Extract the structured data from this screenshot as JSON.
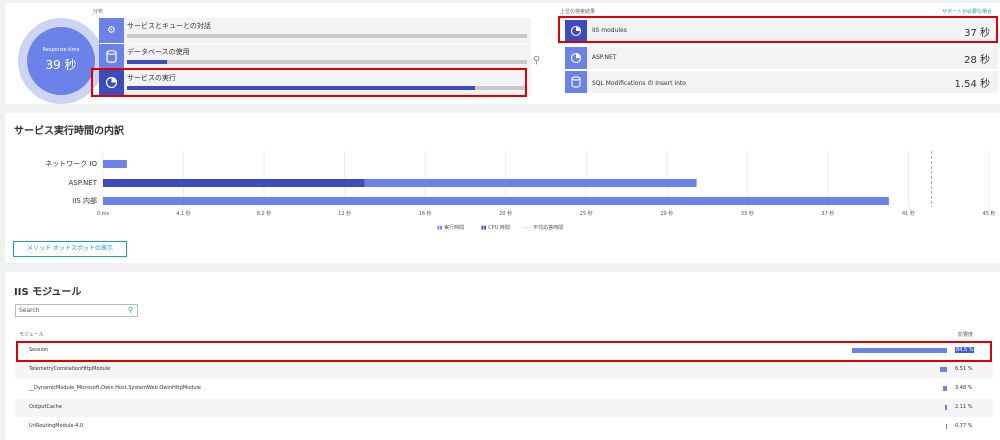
{
  "distribution": {
    "label": "分布",
    "response_time": {
      "label": "Response time",
      "value": "39 秒"
    },
    "items": [
      {
        "label": "サービスとキューとの対話",
        "icon": "gear-icon",
        "fill": 0.0
      },
      {
        "label": "データベースの使用",
        "icon": "database-icon",
        "fill": 0.1
      },
      {
        "label": "サービスの実行",
        "icon": "service-pie-icon",
        "fill": 0.87,
        "selected": true
      }
    ]
  },
  "top_results": {
    "label": "上位の検索結果",
    "help_link": "サポートが必要な場合",
    "items": [
      {
        "label": "IIS modules",
        "value": "37 秒",
        "icon": "service-pie-icon",
        "selected": true
      },
      {
        "label": "ASP.NET",
        "value": "28 秒",
        "icon": "service-pie-icon"
      },
      {
        "label": "SQL Modifications の Insert into",
        "value": "1.54 秒",
        "icon": "database-icon"
      }
    ]
  },
  "breakdown": {
    "title": "サービス実行時間の内訳",
    "hotspot_button": "メソッド ホットスポットの表示",
    "legend": {
      "exec": "実行時間",
      "cpu": "CPU 時間",
      "avg": "平均応答時間"
    }
  },
  "chart_data": {
    "type": "bar",
    "orientation": "horizontal",
    "categories": [
      "ネットワーク IO",
      "ASP.NET",
      "IIS 内部"
    ],
    "series": [
      {
        "name": "実行時間",
        "values": [
          2.7,
          67.0,
          88.7
        ]
      },
      {
        "name": "CPU 時間",
        "values": [
          0,
          29.5,
          0
        ]
      }
    ],
    "x_ticks": [
      "0 ms",
      "4.1 秒",
      "8.2 秒",
      "12 秒",
      "16 秒",
      "20 秒",
      "25 秒",
      "29 秒",
      "33 秒",
      "37 秒",
      "41 秒",
      "45 秒"
    ],
    "x_unit": "percent_of_axis",
    "average_marker": 93.5,
    "colors": {
      "exec": "#6b83e8",
      "cpu": "#3d4bbd",
      "avg": "#999999"
    }
  },
  "iis_modules": {
    "title": "IIS モジュール",
    "search_placeholder": "Search",
    "col_module": "モジュール",
    "col_impact": "影響度",
    "rows": [
      {
        "name": "Session",
        "pct": "84.5 %",
        "value": 84.5,
        "selected": true
      },
      {
        "name": "TelemetryCorrelationHttpModule",
        "pct": "6.51 %",
        "value": 6.51
      },
      {
        "name": "__DynamicModule_Microsoft.Owin.Host.SystemWeb.OwinHttpModule",
        "pct": "3.48 %",
        "value": 3.48
      },
      {
        "name": "OutputCache",
        "pct": "2.11 %",
        "value": 2.11
      },
      {
        "name": "UrlRoutingModule-4.0",
        "pct": "0.77 %",
        "value": 0.77
      }
    ]
  },
  "colors": {
    "accent": "#6b83e8",
    "accent_dark": "#3d4bbd",
    "highlight": "#e00000",
    "link": "#17a2b8"
  }
}
